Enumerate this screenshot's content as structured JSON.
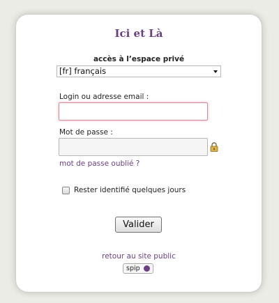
{
  "login": {
    "site_title": "Ici et Là",
    "section_label": "accès à l’espace privé",
    "language": {
      "selected": "[fr] français"
    },
    "login_field": {
      "label": "Login ou adresse email :",
      "value": ""
    },
    "password_field": {
      "label": "Mot de passe :",
      "value": ""
    },
    "forgot_password": "mot de passe oublié ?",
    "remember_me": {
      "label": "Rester identifié quelques jours",
      "checked": false
    },
    "submit_label": "Valider",
    "back_link": "retour au site public",
    "badge": "spip"
  },
  "colors": {
    "accent": "#6b3f85",
    "background": "#ecece6",
    "focus": "#d58a96"
  }
}
